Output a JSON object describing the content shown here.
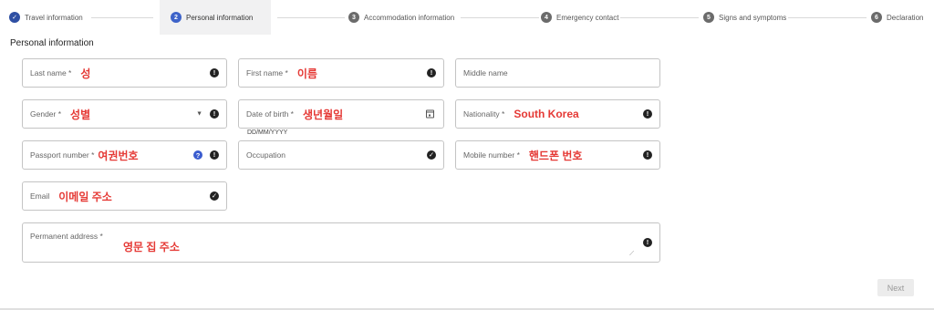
{
  "stepper": {
    "steps": [
      {
        "number": "✓",
        "label": "Travel information",
        "state": "done"
      },
      {
        "number": "2",
        "label": "Personal information",
        "state": "current"
      },
      {
        "number": "3",
        "label": "Accommodation information",
        "state": "pending"
      },
      {
        "number": "4",
        "label": "Emergency contact",
        "state": "pending"
      },
      {
        "number": "5",
        "label": "Signs and symptoms",
        "state": "pending"
      },
      {
        "number": "6",
        "label": "Declaration",
        "state": "pending"
      }
    ]
  },
  "section": {
    "title": "Personal information"
  },
  "form": {
    "last_name": {
      "label": "Last name *",
      "value": "성",
      "icon": "!"
    },
    "first_name": {
      "label": "First name *",
      "value": "이름",
      "icon": "!"
    },
    "middle_name": {
      "label": "Middle name"
    },
    "gender": {
      "label": "Gender *",
      "value": "성별",
      "caret": "▼",
      "icon": "!"
    },
    "date_of_birth": {
      "label": "Date of birth *",
      "value": "생년월일",
      "hint": "DD/MM/YYYY"
    },
    "nationality": {
      "label": "Nationality *",
      "value": "South Korea",
      "icon": "!"
    },
    "passport_number": {
      "label": "Passport number *",
      "value": "여권번호",
      "help": "?",
      "icon": "!"
    },
    "occupation": {
      "label": "Occupation",
      "icon": "✓"
    },
    "mobile_number": {
      "label": "Mobile number *",
      "value": "핸드폰 번호",
      "icon": "!"
    },
    "email": {
      "label": "Email",
      "value": "이메일 주소",
      "icon": "✓"
    },
    "permanent_address": {
      "label": "Permanent address *",
      "value": "영문 집 주소",
      "icon": "!"
    }
  },
  "actions": {
    "next_label": "Next"
  },
  "colors": {
    "accent": "#3e63c9",
    "value_red": "#e53935",
    "valid_black": "#222222"
  }
}
